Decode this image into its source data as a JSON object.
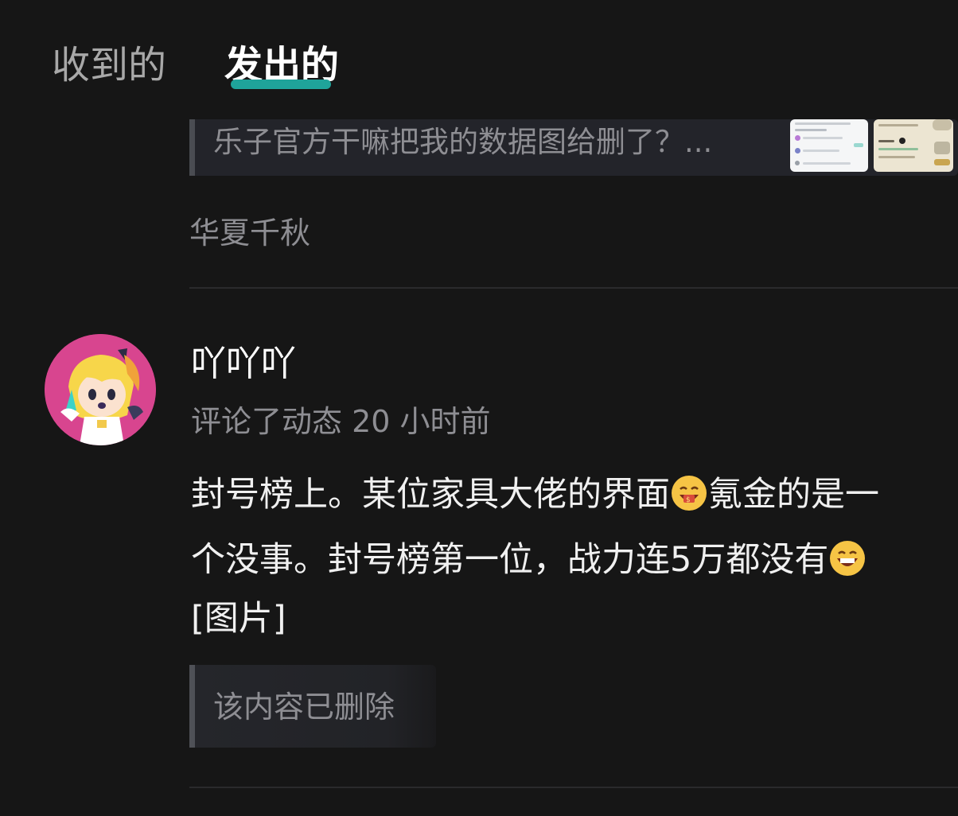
{
  "tabs": {
    "received": "收到的",
    "sent": "发出的",
    "active": "sent"
  },
  "previous_item": {
    "quote_text": "乐子官方干嘛把我的数据图给删了？...",
    "author": "华夏千秋"
  },
  "post": {
    "username": "吖吖吖",
    "meta": "评论了动态 20 小时前",
    "body_line1_a": "封号榜上。某位家具大佬的界面",
    "body_line1_b": "氪金的是一",
    "body_line2_a": "个没事。封号榜第一位，战力连5万都没有",
    "body_line3": "[图片]",
    "deleted_notice": "该内容已删除"
  },
  "colors": {
    "background": "#161616",
    "accent": "#1fa39a",
    "muted_text": "#8e8e93",
    "avatar_bg": "#d8458f"
  },
  "icons": {
    "emoji_1": "money-mouth-emoji",
    "emoji_2": "grinning-emoji"
  }
}
